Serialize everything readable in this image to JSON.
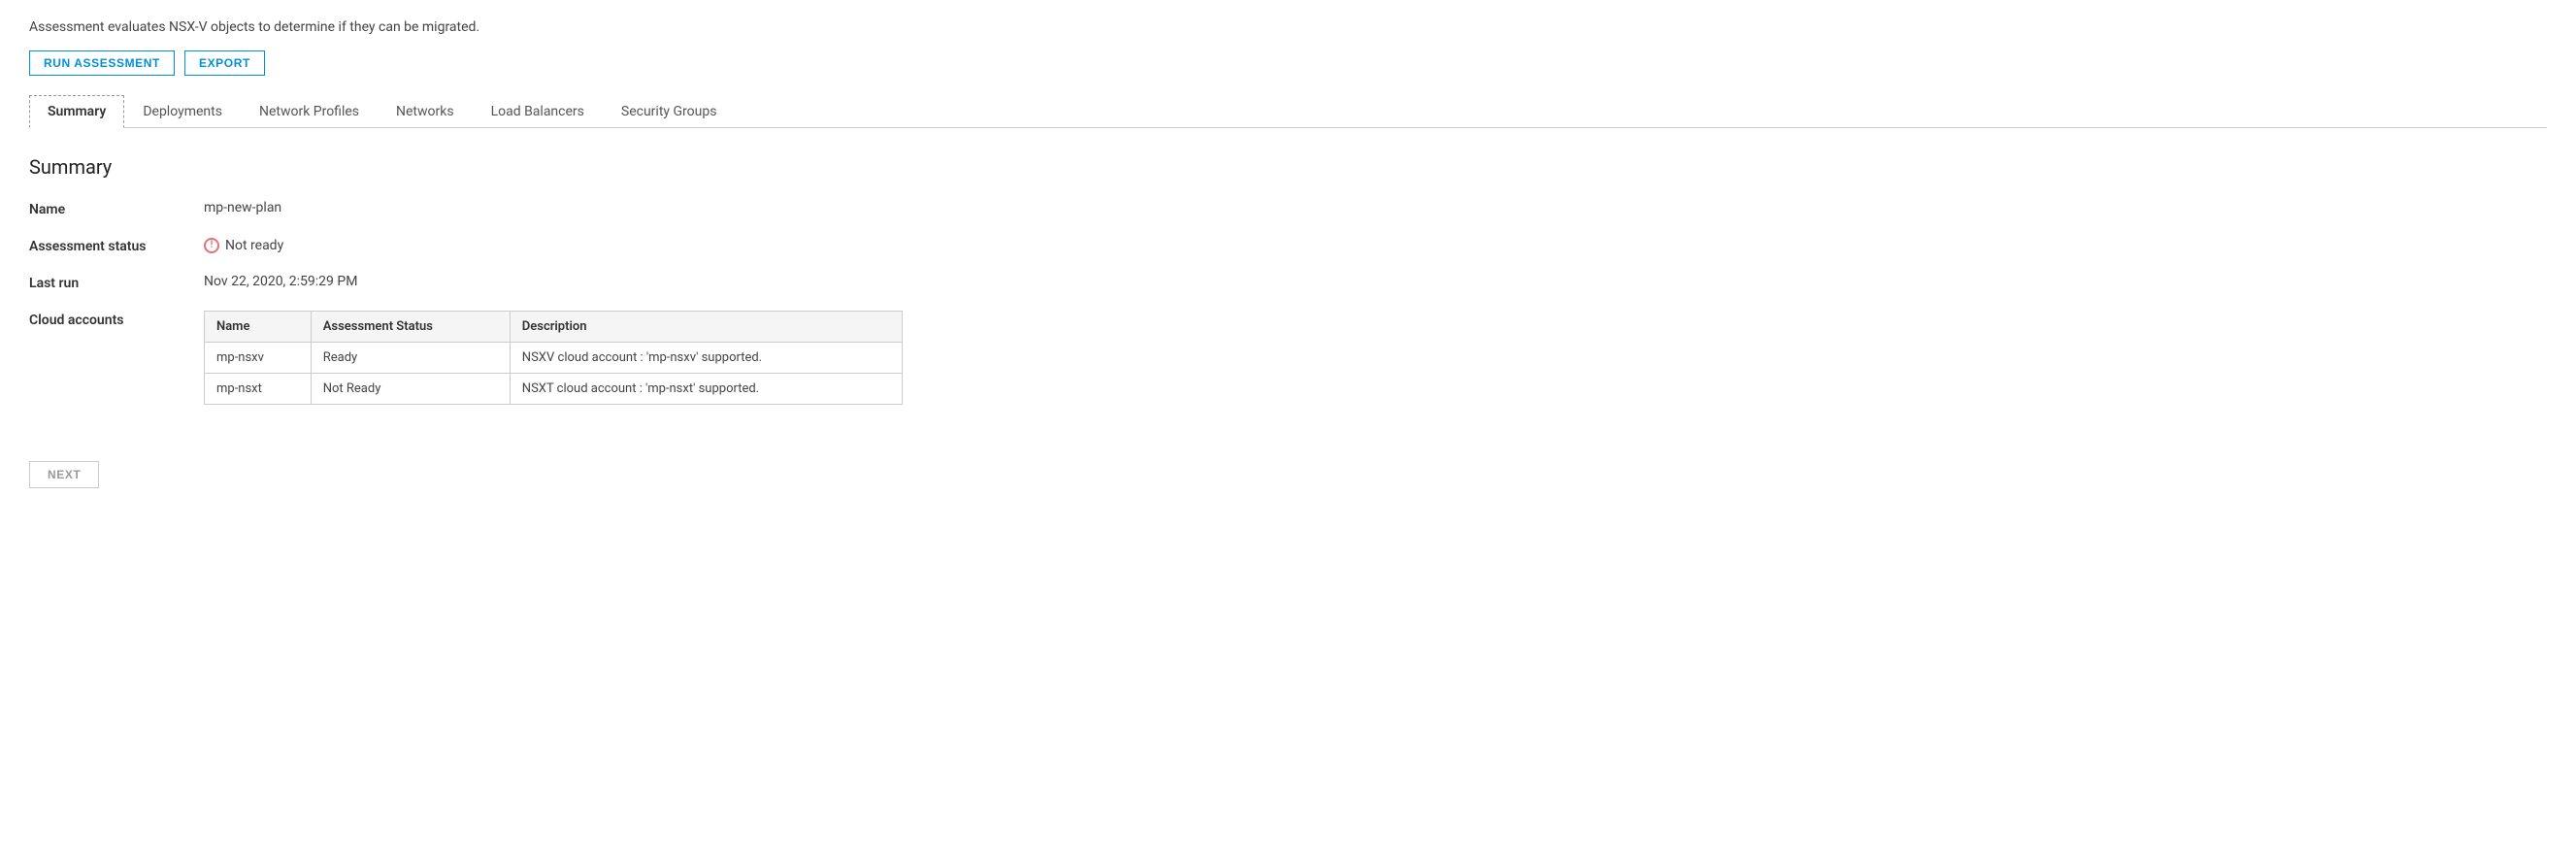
{
  "description": "Assessment evaluates NSX-V objects to determine if they can be migrated.",
  "toolbar": {
    "run_assessment_label": "RUN ASSESSMENT",
    "export_label": "EXPORT"
  },
  "tabs": [
    {
      "id": "summary",
      "label": "Summary",
      "active": true
    },
    {
      "id": "deployments",
      "label": "Deployments",
      "active": false
    },
    {
      "id": "network-profiles",
      "label": "Network Profiles",
      "active": false
    },
    {
      "id": "networks",
      "label": "Networks",
      "active": false
    },
    {
      "id": "load-balancers",
      "label": "Load Balancers",
      "active": false
    },
    {
      "id": "security-groups",
      "label": "Security Groups",
      "active": false
    }
  ],
  "section": {
    "title": "Summary",
    "fields": {
      "name_label": "Name",
      "name_value": "mp-new-plan",
      "status_label": "Assessment status",
      "status_value": "Not ready",
      "last_run_label": "Last run",
      "last_run_value": "Nov 22, 2020, 2:59:29 PM",
      "cloud_accounts_label": "Cloud accounts"
    },
    "table": {
      "columns": [
        "Name",
        "Assessment Status",
        "Description"
      ],
      "rows": [
        {
          "name": "mp-nsxv",
          "status": "Ready",
          "description": "NSXV cloud account : 'mp-nsxv' supported."
        },
        {
          "name": "mp-nsxt",
          "status": "Not Ready",
          "description": "NSXT cloud account : 'mp-nsxt' supported."
        }
      ]
    }
  },
  "next_button_label": "NEXT"
}
